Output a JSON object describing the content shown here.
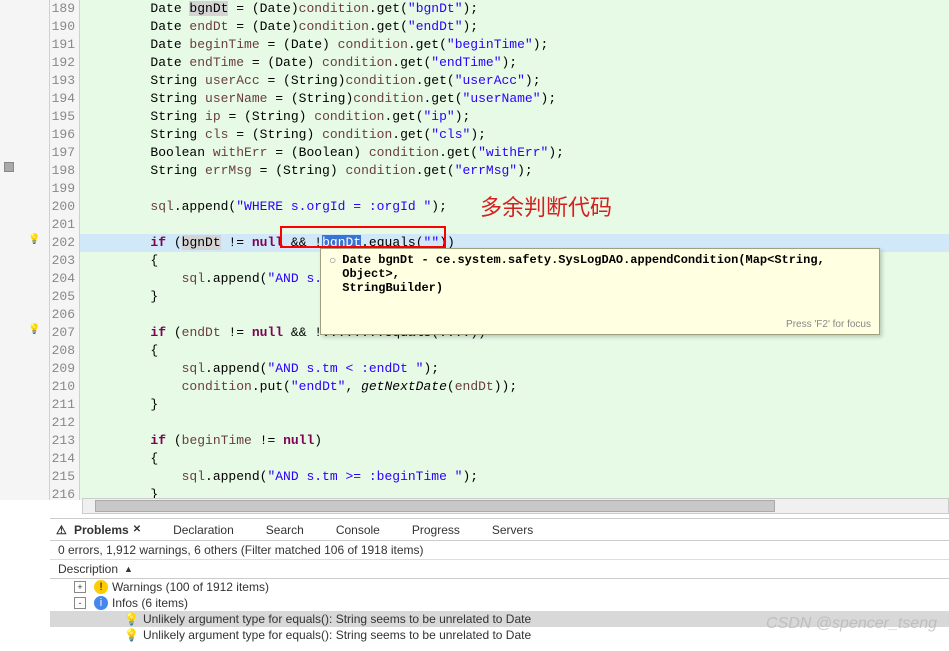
{
  "lines": [
    {
      "n": 189,
      "tokens": [
        {
          "t": "        Date ",
          "c": ""
        },
        {
          "t": "bgnDt",
          "c": "var-hl"
        },
        {
          "t": " = (Date)",
          "c": ""
        },
        {
          "t": "condition",
          "c": "var"
        },
        {
          "t": ".get(",
          "c": ""
        },
        {
          "t": "\"bgnDt\"",
          "c": "str"
        },
        {
          "t": ");",
          "c": ""
        }
      ]
    },
    {
      "n": 190,
      "tokens": [
        {
          "t": "        Date ",
          "c": ""
        },
        {
          "t": "endDt",
          "c": "var"
        },
        {
          "t": " = (Date)",
          "c": ""
        },
        {
          "t": "condition",
          "c": "var"
        },
        {
          "t": ".get(",
          "c": ""
        },
        {
          "t": "\"endDt\"",
          "c": "str"
        },
        {
          "t": ");",
          "c": ""
        }
      ]
    },
    {
      "n": 191,
      "tokens": [
        {
          "t": "        Date ",
          "c": ""
        },
        {
          "t": "beginTime",
          "c": "var"
        },
        {
          "t": " = (Date) ",
          "c": ""
        },
        {
          "t": "condition",
          "c": "var"
        },
        {
          "t": ".get(",
          "c": ""
        },
        {
          "t": "\"beginTime\"",
          "c": "str"
        },
        {
          "t": ");",
          "c": ""
        }
      ]
    },
    {
      "n": 192,
      "tokens": [
        {
          "t": "        Date ",
          "c": ""
        },
        {
          "t": "endTime",
          "c": "var"
        },
        {
          "t": " = (Date) ",
          "c": ""
        },
        {
          "t": "condition",
          "c": "var"
        },
        {
          "t": ".get(",
          "c": ""
        },
        {
          "t": "\"endTime\"",
          "c": "str"
        },
        {
          "t": ");",
          "c": ""
        }
      ]
    },
    {
      "n": 193,
      "tokens": [
        {
          "t": "        String ",
          "c": ""
        },
        {
          "t": "userAcc",
          "c": "var"
        },
        {
          "t": " = (String)",
          "c": ""
        },
        {
          "t": "condition",
          "c": "var"
        },
        {
          "t": ".get(",
          "c": ""
        },
        {
          "t": "\"userAcc\"",
          "c": "str"
        },
        {
          "t": ");",
          "c": ""
        }
      ]
    },
    {
      "n": 194,
      "tokens": [
        {
          "t": "        String ",
          "c": ""
        },
        {
          "t": "userName",
          "c": "var"
        },
        {
          "t": " = (String)",
          "c": ""
        },
        {
          "t": "condition",
          "c": "var"
        },
        {
          "t": ".get(",
          "c": ""
        },
        {
          "t": "\"userName\"",
          "c": "str"
        },
        {
          "t": ");",
          "c": ""
        }
      ]
    },
    {
      "n": 195,
      "tokens": [
        {
          "t": "        String ",
          "c": ""
        },
        {
          "t": "ip",
          "c": "var"
        },
        {
          "t": " = (String) ",
          "c": ""
        },
        {
          "t": "condition",
          "c": "var"
        },
        {
          "t": ".get(",
          "c": ""
        },
        {
          "t": "\"ip\"",
          "c": "str"
        },
        {
          "t": ");",
          "c": ""
        }
      ]
    },
    {
      "n": 196,
      "tokens": [
        {
          "t": "        String ",
          "c": ""
        },
        {
          "t": "cls",
          "c": "var"
        },
        {
          "t": " = (String) ",
          "c": ""
        },
        {
          "t": "condition",
          "c": "var"
        },
        {
          "t": ".get(",
          "c": ""
        },
        {
          "t": "\"cls\"",
          "c": "str"
        },
        {
          "t": ");",
          "c": ""
        }
      ]
    },
    {
      "n": 197,
      "tokens": [
        {
          "t": "        Boolean ",
          "c": ""
        },
        {
          "t": "withErr",
          "c": "var"
        },
        {
          "t": " = (Boolean) ",
          "c": ""
        },
        {
          "t": "condition",
          "c": "var"
        },
        {
          "t": ".get(",
          "c": ""
        },
        {
          "t": "\"withErr\"",
          "c": "str"
        },
        {
          "t": ");",
          "c": ""
        }
      ]
    },
    {
      "n": 198,
      "tokens": [
        {
          "t": "        String ",
          "c": ""
        },
        {
          "t": "errMsg",
          "c": "var"
        },
        {
          "t": " = (String) ",
          "c": ""
        },
        {
          "t": "condition",
          "c": "var"
        },
        {
          "t": ".get(",
          "c": ""
        },
        {
          "t": "\"errMsg\"",
          "c": "str"
        },
        {
          "t": ");",
          "c": ""
        }
      ]
    },
    {
      "n": 199,
      "tokens": []
    },
    {
      "n": 200,
      "tokens": [
        {
          "t": "        ",
          "c": ""
        },
        {
          "t": "sql",
          "c": "var"
        },
        {
          "t": ".append(",
          "c": ""
        },
        {
          "t": "\"WHERE s.orgId = :orgId \"",
          "c": "str"
        },
        {
          "t": ");",
          "c": ""
        }
      ]
    },
    {
      "n": 201,
      "tokens": []
    },
    {
      "n": 202,
      "hl": true,
      "tokens": [
        {
          "t": "        ",
          "c": ""
        },
        {
          "t": "if",
          "c": "kw"
        },
        {
          "t": " (",
          "c": ""
        },
        {
          "t": "bgnDt",
          "c": "var-hl"
        },
        {
          "t": " != ",
          "c": ""
        },
        {
          "t": "null",
          "c": "kw"
        },
        {
          "t": " && !",
          "c": ""
        },
        {
          "t": "bgnDt",
          "c": "sel"
        },
        {
          "t": ".equals(",
          "c": ""
        },
        {
          "t": "\"\"",
          "c": "str"
        },
        {
          "t": "))",
          "c": ""
        }
      ]
    },
    {
      "n": 203,
      "tokens": [
        {
          "t": "        {",
          "c": ""
        }
      ]
    },
    {
      "n": 204,
      "tokens": [
        {
          "t": "            ",
          "c": ""
        },
        {
          "t": "sql",
          "c": "var"
        },
        {
          "t": ".append(",
          "c": ""
        },
        {
          "t": "\"AND s.",
          "c": "str"
        }
      ]
    },
    {
      "n": 205,
      "tokens": [
        {
          "t": "        }",
          "c": ""
        }
      ]
    },
    {
      "n": 206,
      "tokens": []
    },
    {
      "n": 207,
      "tokens": [
        {
          "t": "        ",
          "c": ""
        },
        {
          "t": "if",
          "c": "kw"
        },
        {
          "t": " (",
          "c": ""
        },
        {
          "t": "endDt",
          "c": "var"
        },
        {
          "t": " != ",
          "c": ""
        },
        {
          "t": "null",
          "c": "kw"
        },
        {
          "t": " && !",
          "c": ""
        },
        {
          "t": "........equals(",
          "c": ""
        },
        {
          "t": "....",
          "c": ""
        },
        {
          "t": "))",
          "c": ""
        }
      ]
    },
    {
      "n": 208,
      "tokens": [
        {
          "t": "        {",
          "c": ""
        }
      ]
    },
    {
      "n": 209,
      "tokens": [
        {
          "t": "            ",
          "c": ""
        },
        {
          "t": "sql",
          "c": "var"
        },
        {
          "t": ".append(",
          "c": ""
        },
        {
          "t": "\"AND s.tm < :endDt \"",
          "c": "str"
        },
        {
          "t": ");",
          "c": ""
        }
      ]
    },
    {
      "n": 210,
      "tokens": [
        {
          "t": "            ",
          "c": ""
        },
        {
          "t": "condition",
          "c": "var"
        },
        {
          "t": ".put(",
          "c": ""
        },
        {
          "t": "\"endDt\"",
          "c": "str"
        },
        {
          "t": ", ",
          "c": ""
        },
        {
          "t": "getNextDate",
          "c": "fn"
        },
        {
          "t": "(",
          "c": ""
        },
        {
          "t": "endDt",
          "c": "var"
        },
        {
          "t": "));",
          "c": ""
        }
      ]
    },
    {
      "n": 211,
      "tokens": [
        {
          "t": "        }",
          "c": ""
        }
      ]
    },
    {
      "n": 212,
      "tokens": []
    },
    {
      "n": 213,
      "tokens": [
        {
          "t": "        ",
          "c": ""
        },
        {
          "t": "if",
          "c": "kw"
        },
        {
          "t": " (",
          "c": ""
        },
        {
          "t": "beginTime",
          "c": "var"
        },
        {
          "t": " != ",
          "c": ""
        },
        {
          "t": "null",
          "c": "kw"
        },
        {
          "t": ")",
          "c": ""
        }
      ]
    },
    {
      "n": 214,
      "tokens": [
        {
          "t": "        {",
          "c": ""
        }
      ]
    },
    {
      "n": 215,
      "tokens": [
        {
          "t": "            ",
          "c": ""
        },
        {
          "t": "sql",
          "c": "var"
        },
        {
          "t": ".append(",
          "c": ""
        },
        {
          "t": "\"AND s.tm >= :beginTime \"",
          "c": "str"
        },
        {
          "t": ");",
          "c": ""
        }
      ]
    },
    {
      "n": 216,
      "tokens": [
        {
          "t": "        }",
          "c": ""
        }
      ]
    }
  ],
  "annotation": "多余判断代码",
  "tooltip": {
    "line1": "Date bgnDt - ce.system.safety.SysLogDAO.appendCondition(Map<String, Object>,",
    "line2": "StringBuilder)",
    "hint": "Press 'F2' for focus"
  },
  "problems": {
    "tabs": [
      {
        "label": "Problems",
        "active": true
      },
      {
        "label": "Declaration"
      },
      {
        "label": "Search"
      },
      {
        "label": "Console"
      },
      {
        "label": "Progress"
      },
      {
        "label": "Servers"
      }
    ],
    "summary": "0 errors, 1,912 warnings, 6 others (Filter matched 106 of 1918 items)",
    "col_header": "Description",
    "rows": [
      {
        "type": "warn-group",
        "exp": "+",
        "text": "Warnings (100 of 1912 items)"
      },
      {
        "type": "info-group",
        "exp": "-",
        "text": "Infos (6 items)"
      },
      {
        "type": "info-item",
        "hl": true,
        "text": "Unlikely argument type for equals(): String seems to be unrelated to Date"
      },
      {
        "type": "info-item",
        "text": "Unlikely argument type for equals(): String seems to be unrelated to Date"
      }
    ]
  },
  "watermark": "CSDN @spencer_tseng"
}
